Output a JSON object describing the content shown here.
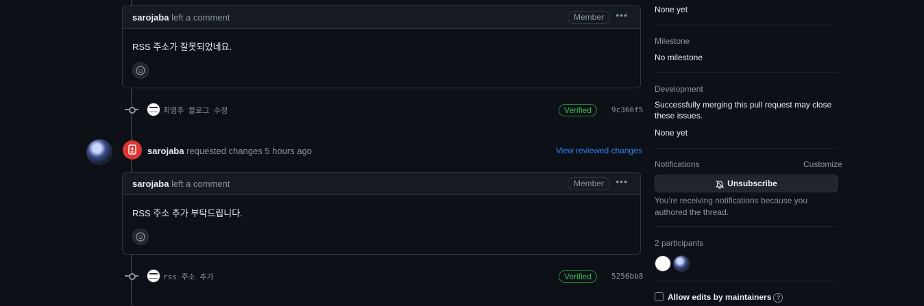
{
  "comment1": {
    "author": "sarojaba",
    "action": "left a comment",
    "badge": "Member",
    "body": "RSS 주소가 잘못되었네요."
  },
  "commit1": {
    "message": "최영주 블로그 수정",
    "status": "Verified",
    "sha": "9c366f5"
  },
  "review": {
    "author": "sarojaba",
    "text": "requested changes 5 hours ago",
    "link": "View reviewed changes"
  },
  "comment2": {
    "author": "sarojaba",
    "action": "left a comment",
    "badge": "Member",
    "body": "RSS 주소 추가 부탁드립니다."
  },
  "commit2": {
    "message": "rss 주소 추가",
    "status": "Verified",
    "sha": "5256bb8"
  },
  "sidebar": {
    "top_value": "None yet",
    "milestone": {
      "heading": "Milestone",
      "value": "No milestone"
    },
    "development": {
      "heading": "Development",
      "text": "Successfully merging this pull request may close these issues.",
      "value": "None yet"
    },
    "notifications": {
      "heading": "Notifications",
      "customize": "Customize",
      "button": "Unsubscribe",
      "note": "You’re receiving notifications because you authored the thread."
    },
    "participants": {
      "heading": "2 participants"
    },
    "allow_edits": "Allow edits by maintainers",
    "help_glyph": "?"
  },
  "colors": {
    "accent": "#2f81f7",
    "verified": "#3fb950",
    "danger": "#da3633"
  }
}
